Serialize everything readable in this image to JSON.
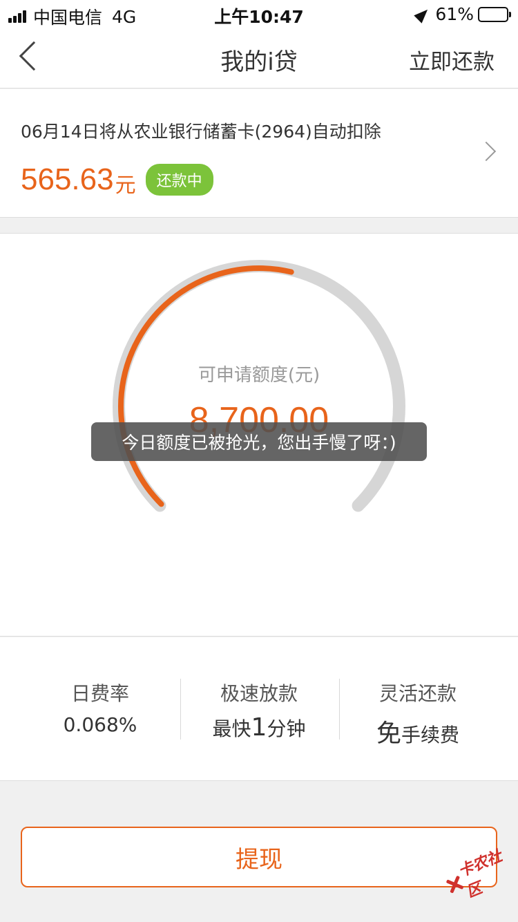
{
  "status_bar": {
    "carrier": "中国电信",
    "network": "4G",
    "time": "上午10:47",
    "battery_percent": "61%",
    "battery_level": 0.61
  },
  "nav": {
    "title": "我的i贷",
    "right_action": "立即还款"
  },
  "repayment": {
    "description": "06月14日将从农业银行储蓄卡(2964)自动扣除",
    "amount": "565.63",
    "unit": "元",
    "status": "还款中"
  },
  "credit": {
    "label": "可申请额度(元)",
    "amount": "8,700.00",
    "gauge_fill": 0.55,
    "toast": "今日额度已被抢光，您出手慢了呀：)"
  },
  "features": [
    {
      "title": "日费率",
      "value_prefix": "",
      "value_big": "0.068%",
      "value_suffix": ""
    },
    {
      "title": "极速放款",
      "value_prefix": "最快",
      "value_big": "1",
      "value_suffix": "分钟"
    },
    {
      "title": "灵活还款",
      "value_prefix": "",
      "value_big": "免",
      "value_suffix": "手续费"
    }
  ],
  "actions": {
    "withdraw_label": "提现"
  },
  "watermark": {
    "text": "卡农社区"
  },
  "colors": {
    "accent": "#e8641b",
    "badge_green": "#7cc33a",
    "gauge_track": "#d6d6d6"
  }
}
